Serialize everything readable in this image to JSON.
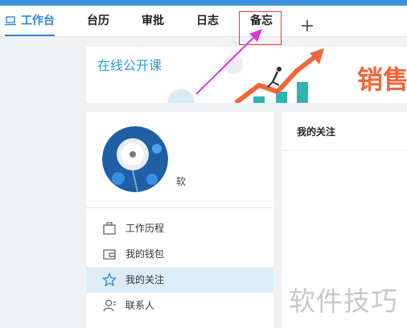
{
  "tabs": [
    {
      "label": "工作台",
      "active": true,
      "icon": "laptop-icon"
    },
    {
      "label": "台历",
      "active": false
    },
    {
      "label": "审批",
      "active": false
    },
    {
      "label": "日志",
      "active": false
    },
    {
      "label": "备忘",
      "active": false
    }
  ],
  "add_tab_symbol": "+",
  "banner": {
    "title": "在线公开课",
    "sales_text": "销售"
  },
  "profile": {
    "partial_text": "软"
  },
  "menu": [
    {
      "label": "工作历程",
      "icon": "briefcase-icon",
      "active": false
    },
    {
      "label": "我的钱包",
      "icon": "wallet-icon",
      "active": false
    },
    {
      "label": "我的关注",
      "icon": "star-icon",
      "active": true
    },
    {
      "label": "联系人",
      "icon": "contact-icon",
      "active": false
    }
  ],
  "right_panel": {
    "title": "我的关注"
  },
  "watermark": "软件技巧",
  "colors": {
    "accent": "#2b86d8",
    "highlight_box": "#e83a3a",
    "annotation_arrow": "#d63ad6",
    "banner_orange": "#f0663a"
  }
}
